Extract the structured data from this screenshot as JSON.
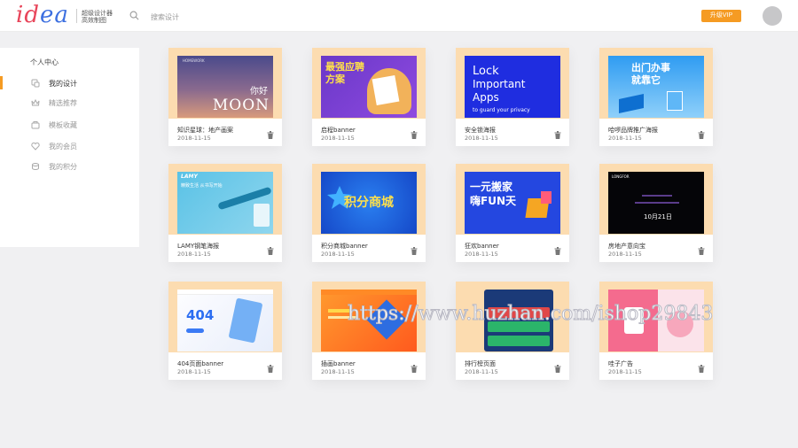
{
  "header": {
    "logo_main": "id",
    "logo_tail": "ea",
    "tagline_line1": "超级设计器",
    "tagline_line2": "高效制图",
    "search_placeholder": "搜索设计",
    "vip_label": "升级VIP",
    "accent_color": "#f59b23"
  },
  "sidebar": {
    "title": "个人中心",
    "items": [
      {
        "label": "我的设计",
        "icon": "design-icon",
        "active": true
      },
      {
        "label": "精选推荐",
        "icon": "crown-icon",
        "active": false
      },
      {
        "label": "模板收藏",
        "icon": "favorite-icon",
        "active": false
      },
      {
        "label": "我的会员",
        "icon": "member-icon",
        "active": false
      },
      {
        "label": "我的积分",
        "icon": "points-icon",
        "active": false
      }
    ]
  },
  "cards": [
    {
      "name": "知识星球：地产画案",
      "date": "2018-11-15",
      "preview": [
        "MOON",
        "你好"
      ]
    },
    {
      "name": "启程banner",
      "date": "2018-11-15",
      "preview": [
        "最强应聘",
        "方案"
      ]
    },
    {
      "name": "安全锁海报",
      "date": "2018-11-15",
      "preview": [
        "Lock",
        "Important",
        "Apps",
        "to guard your privacy"
      ]
    },
    {
      "name": "哈啰品牌推广海报",
      "date": "2018-11-15",
      "preview": [
        "出门办事",
        "就靠它"
      ]
    },
    {
      "name": "LAMY钢笔海报",
      "date": "2018-11-15",
      "preview": [
        "LAMY",
        "精致生活 从书写开始"
      ]
    },
    {
      "name": "积分商城banner",
      "date": "2018-11-15",
      "preview": [
        "积分商城"
      ]
    },
    {
      "name": "狂欢banner",
      "date": "2018-11-15",
      "preview": [
        "一元搬家",
        "嗨FUN天"
      ]
    },
    {
      "name": "房地产意向宝",
      "date": "2018-11-15",
      "preview": [
        "LONGFOR",
        "10月21日"
      ]
    },
    {
      "name": "404页面banner",
      "date": "2018-11-15",
      "preview": [
        "404"
      ]
    },
    {
      "name": "插画banner",
      "date": "2018-11-15",
      "preview": []
    },
    {
      "name": "排行榜页面",
      "date": "2018-11-15",
      "preview": []
    },
    {
      "name": "哇子广告",
      "date": "2018-11-15",
      "preview": []
    }
  ],
  "watermark": "https://www.huzhan.com/ishop29843"
}
